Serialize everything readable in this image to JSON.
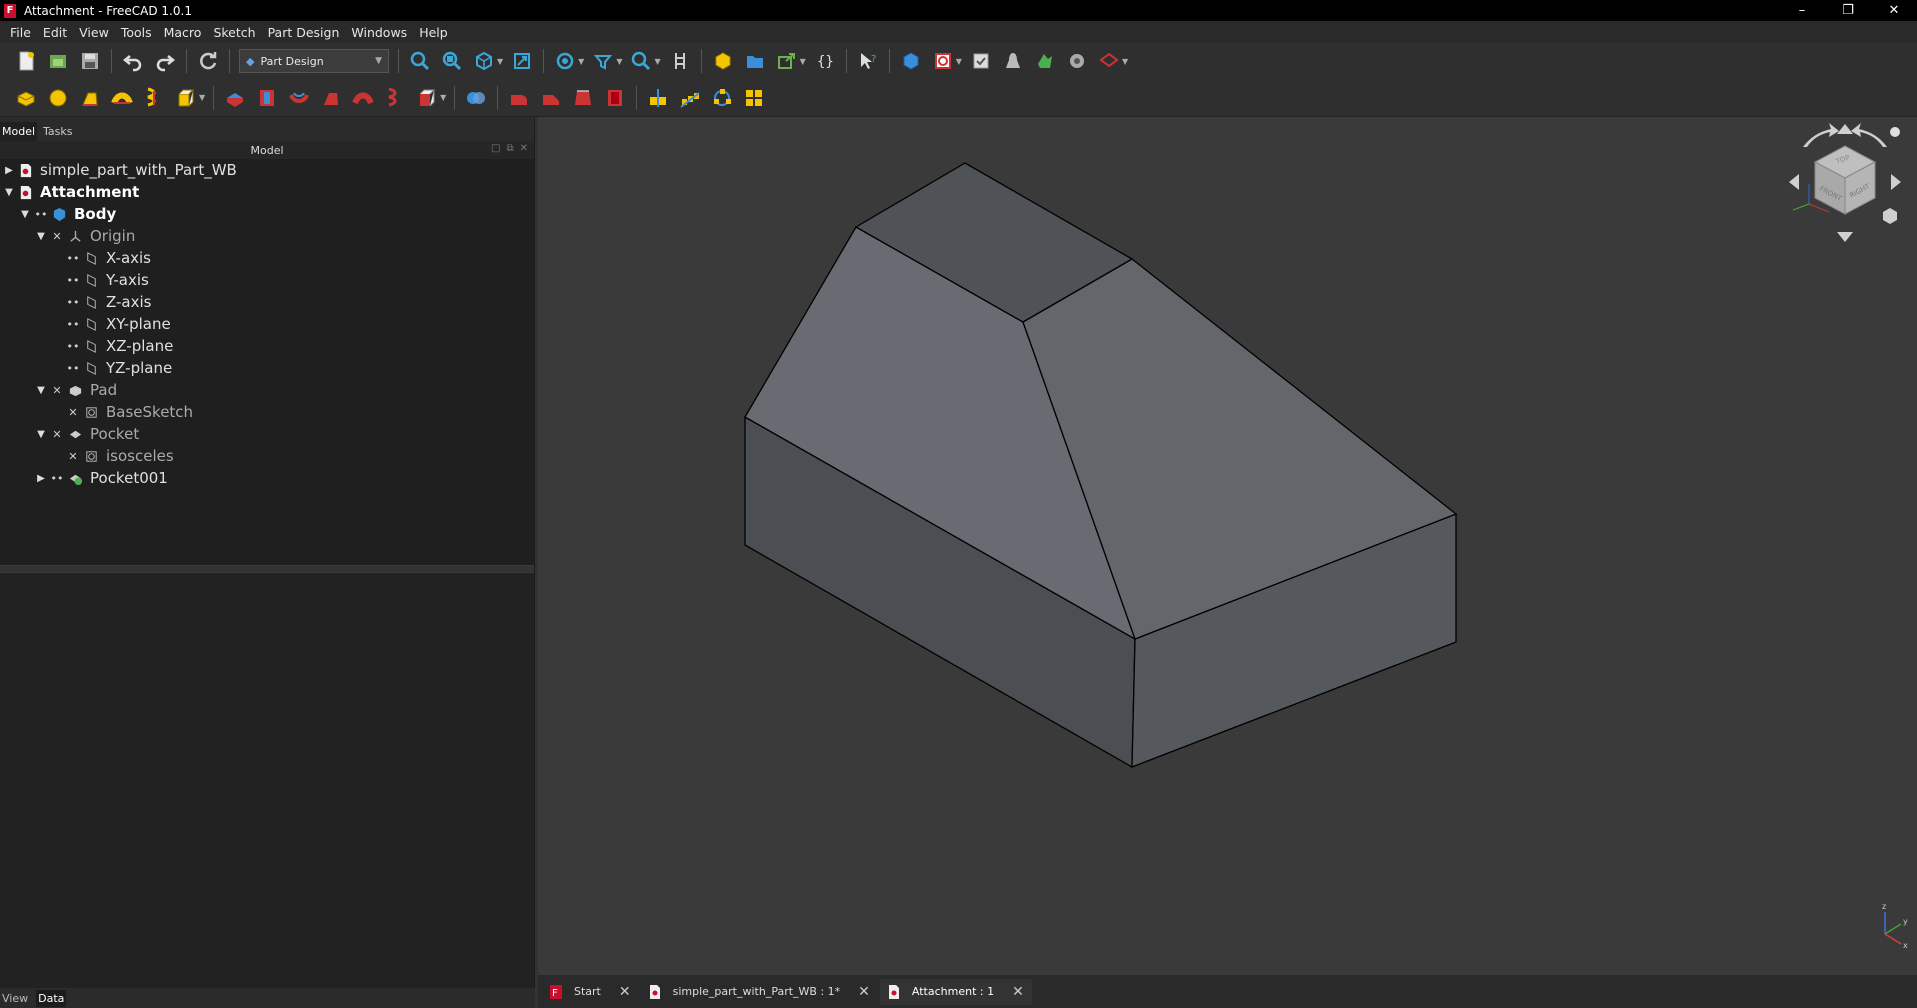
{
  "window": {
    "title": "Attachment - FreeCAD 1.0.1",
    "minimize": "–",
    "restore": "❐",
    "close": "✕"
  },
  "menu": [
    {
      "key": "file",
      "label": "File"
    },
    {
      "key": "edit",
      "label": "Edit"
    },
    {
      "key": "view",
      "label": "View"
    },
    {
      "key": "tools",
      "label": "Tools"
    },
    {
      "key": "macro",
      "label": "Macro"
    },
    {
      "key": "sketch",
      "label": "Sketch"
    },
    {
      "key": "part-design",
      "label": "Part Design"
    },
    {
      "key": "windows",
      "label": "Windows"
    },
    {
      "key": "help",
      "label": "Help"
    }
  ],
  "toolbar": {
    "workbench": "Part Design"
  },
  "combo": {
    "tabs": {
      "model": "Model",
      "tasks": "Tasks"
    },
    "header": "Model",
    "prop_tabs": {
      "view": "View",
      "data": "Data"
    }
  },
  "tree": {
    "doc1": "simple_part_with_Part_WB",
    "doc2": "Attachment",
    "body": "Body",
    "origin": "Origin",
    "x_axis": "X-axis",
    "y_axis": "Y-axis",
    "z_axis": "Z-axis",
    "xy_plane": "XY-plane",
    "xz_plane": "XZ-plane",
    "yz_plane": "YZ-plane",
    "pad": "Pad",
    "base_sketch": "BaseSketch",
    "pocket": "Pocket",
    "isosceles": "isosceles",
    "pocket001": "Pocket001"
  },
  "doc_tabs": {
    "start": "Start",
    "simple": "simple_part_with_Part_WB : 1*",
    "attachment": "Attachment : 1"
  },
  "navcube": {
    "top": "TOP",
    "front": "FRONT",
    "right": "RIGHT"
  },
  "axis": {
    "x": "x",
    "y": "y",
    "z": "z"
  },
  "colors": {
    "accent_red": "#c8102e",
    "face_top": "#4f5357",
    "face_left_slope": "#666a70",
    "face_right_slope": "#62666b",
    "face_front_left": "#4b4f53",
    "face_front_right": "#55595e"
  }
}
